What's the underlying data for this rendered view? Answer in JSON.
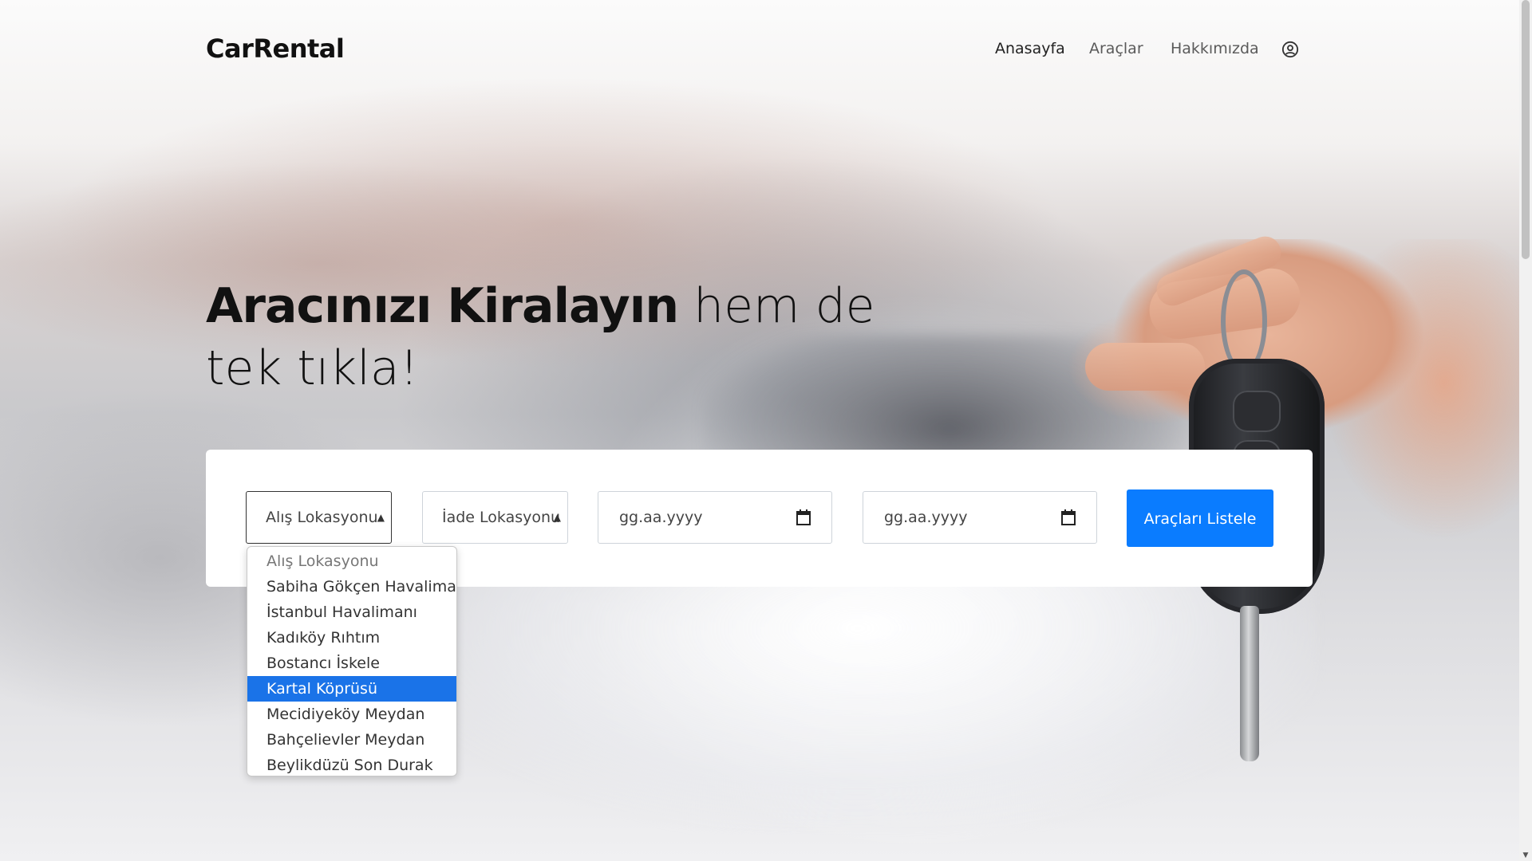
{
  "navbar": {
    "brand": "CarRental",
    "links": [
      "Anasayfa",
      "Araçlar",
      "Hakkımızda"
    ],
    "user_icon": "user-circle-icon"
  },
  "hero": {
    "title_bold": "Aracınızı Kiralayın",
    "title_rest_line1": " hem de",
    "title_line2": "tek tıkla!"
  },
  "search": {
    "pickup_select": "Alış Lokasyonu",
    "return_select": "İade Lokasyonu",
    "start_date_placeholder": "gg.aa.yyyy",
    "end_date_placeholder": "gg.aa.yyyy",
    "calendar_icon": "calendar-icon",
    "submit_label": "Araçları Listele"
  },
  "dropdown": {
    "options": [
      "Alış Lokasyonu",
      "Sabiha Gökçen Havalimanı",
      "İstanbul Havalimanı",
      "Kadıköy Rıhtım",
      "Bostancı İskele",
      "Kartal Köprüsü",
      "Mecidiyeköy Meydan",
      "Bahçelievler Meydan",
      "Beylikdüzü Son Durak"
    ],
    "highlighted": "Kartal Köprüsü",
    "highlight_color": "#1a73e8"
  },
  "colors": {
    "primary_button": "#0a7cff"
  }
}
